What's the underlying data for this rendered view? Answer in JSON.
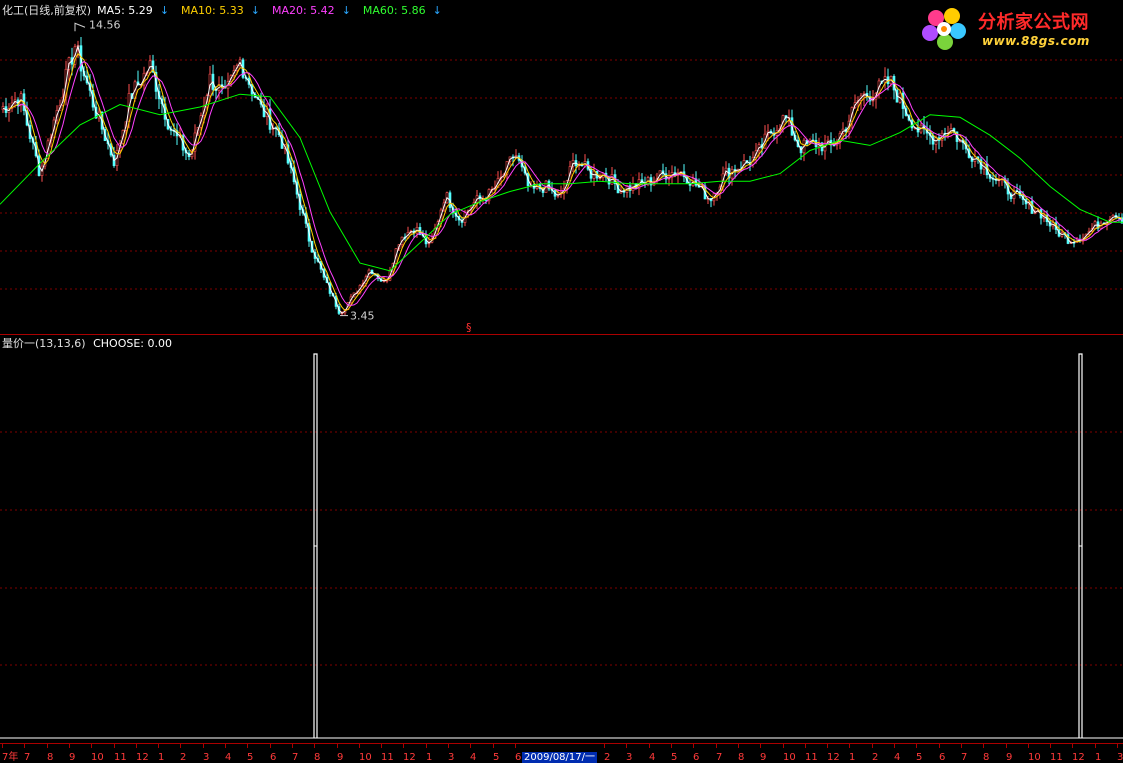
{
  "header": {
    "title": "化工(日线,前复权)",
    "ma5_label": "MA5: 5.29",
    "ma10_label": "MA10: 5.33",
    "ma20_label": "MA20: 5.42",
    "ma60_label": "MA60: 5.86",
    "arrow": "↓"
  },
  "logo": {
    "name": "分析家公式网",
    "url": "www.88gs.com"
  },
  "section_mark": "§",
  "indicator": {
    "title": "量价一(13,13,6)",
    "value_label": "CHOOSE: 0.00"
  },
  "axis": {
    "date_box": "2009/08/17/一",
    "ticks": [
      "7年",
      "7",
      "8",
      "9",
      "10",
      "11",
      "12",
      "1",
      "2",
      "3",
      "4",
      "5",
      "6",
      "7",
      "8",
      "9",
      "10",
      "11",
      "12",
      "1",
      "3",
      "4",
      "5",
      "6",
      "7",
      "8",
      "1",
      "2",
      "3",
      "4",
      "5",
      "6",
      "7",
      "8",
      "9",
      "10",
      "11",
      "12",
      "1",
      "2",
      "4",
      "5",
      "6",
      "7",
      "8",
      "9",
      "10",
      "11",
      "12",
      "1",
      "3"
    ]
  },
  "colors": {
    "background": "#000000",
    "grid": "#800000",
    "up_candle": "#ff5050",
    "down_candle": "#54ffff",
    "ma5": "#ffffff",
    "ma10": "#ffd000",
    "ma20": "#ff40ff",
    "ma60": "#00ff00",
    "indicator_line": "#ffffff"
  },
  "chart_data": [
    {
      "type": "line",
      "panel": "price",
      "title": "化工(日线,前复权)",
      "x_units": "trading days (approximate index, ~1260 days)",
      "y_range": [
        3.45,
        14.56
      ],
      "annotations": [
        {
          "label": "14.56",
          "kind": "high",
          "x": 75,
          "y": 14.56
        },
        {
          "label": "3.45",
          "kind": "low",
          "x": 340,
          "y": 3.45
        }
      ],
      "series": [
        {
          "name": "Close (approx.)",
          "x": [
            0,
            20,
            40,
            55,
            75,
            95,
            115,
            130,
            150,
            170,
            190,
            210,
            225,
            240,
            260,
            280,
            295,
            310,
            325,
            340,
            355,
            370,
            385,
            400,
            415,
            430,
            445,
            460,
            475,
            490,
            500,
            515,
            530,
            545,
            560,
            575,
            590,
            605,
            620,
            635,
            650,
            665,
            680,
            695,
            710,
            725,
            740,
            755,
            770,
            785,
            800,
            815,
            830,
            845,
            860,
            875,
            890,
            905,
            920,
            935,
            950,
            965,
            980,
            995,
            1010,
            1025,
            1040,
            1055,
            1070,
            1085,
            1100,
            1115,
            1123
          ],
          "y": [
            11.5,
            12.0,
            9.0,
            11.2,
            14.0,
            11.5,
            9.4,
            12.0,
            13.2,
            10.8,
            9.6,
            12.7,
            12.0,
            13.4,
            11.6,
            10.5,
            8.5,
            6.3,
            4.8,
            3.55,
            4.3,
            5.3,
            4.7,
            6.5,
            6.9,
            6.1,
            8.2,
            7.2,
            7.9,
            8.2,
            8.7,
            9.8,
            8.3,
            8.5,
            8.0,
            9.6,
            9.0,
            9.0,
            8.4,
            8.5,
            8.7,
            9.0,
            9.1,
            8.6,
            8.0,
            9.0,
            9.3,
            9.6,
            10.6,
            11.2,
            10.0,
            10.2,
            10.0,
            10.8,
            12.0,
            12.2,
            12.6,
            11.5,
            10.6,
            10.4,
            10.8,
            10.0,
            9.5,
            8.8,
            8.3,
            7.8,
            7.5,
            6.8,
            6.4,
            6.6,
            7.1,
            7.5,
            7.2
          ]
        },
        {
          "name": "MA60 (approx.)",
          "x": [
            0,
            40,
            80,
            120,
            160,
            200,
            240,
            270,
            300,
            330,
            360,
            390,
            420,
            450,
            480,
            510,
            540,
            570,
            600,
            630,
            660,
            690,
            720,
            750,
            780,
            810,
            840,
            870,
            900,
            930,
            960,
            990,
            1020,
            1050,
            1080,
            1110,
            1123
          ],
          "y": [
            7.8,
            9.4,
            10.9,
            11.7,
            11.3,
            11.6,
            12.1,
            12.0,
            10.4,
            7.5,
            5.5,
            5.2,
            6.3,
            7.4,
            7.9,
            8.3,
            8.6,
            8.6,
            8.7,
            8.6,
            8.6,
            8.6,
            8.7,
            8.7,
            9.0,
            9.9,
            10.3,
            10.1,
            10.6,
            11.3,
            11.2,
            10.5,
            9.6,
            8.5,
            7.6,
            7.1,
            7.1
          ]
        }
      ],
      "legend": [
        "MA5: 5.29",
        "MA10: 5.33",
        "MA20: 5.42",
        "MA60: 5.86"
      ]
    },
    {
      "type": "line",
      "panel": "indicator",
      "title": "量价一(13,13,6)",
      "series": [
        {
          "name": "CHOOSE",
          "spikes": [
            {
              "x_day": 316,
              "peak": 1.0,
              "mid": 0.5
            },
            {
              "x_day": 1081,
              "peak": 1.0,
              "mid": 0.5
            }
          ],
          "baseline": 0.0,
          "last_value": 0.0
        }
      ]
    }
  ]
}
